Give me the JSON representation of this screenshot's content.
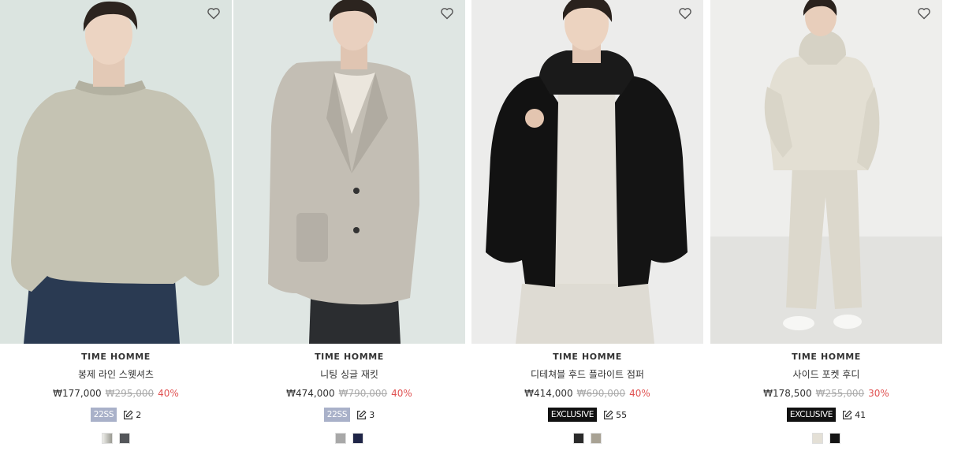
{
  "products": [
    {
      "brand": "TIME HOMME",
      "name": "봉제 라인 스웻셔츠",
      "price": "₩177,000",
      "original_price": "₩295,000",
      "discount": "40%",
      "badge": "22SS",
      "badge_type": "season",
      "reviews": "2",
      "colors": [
        "#dcdad2",
        "#54565a"
      ],
      "bg": "#dbe4e0"
    },
    {
      "brand": "TIME HOMME",
      "name": "니팅 싱글 재킷",
      "price": "₩474,000",
      "original_price": "₩790,000",
      "discount": "40%",
      "badge": "22SS",
      "badge_type": "season",
      "reviews": "3",
      "colors": [
        "#a8a8a8",
        "#1f2547"
      ],
      "bg": "#dfe6e3"
    },
    {
      "brand": "TIME HOMME",
      "name": "디테쳐블 후드 플라이트 점퍼",
      "price": "₩414,000",
      "original_price": "₩690,000",
      "discount": "40%",
      "badge": "EXCLUSIVE",
      "badge_type": "exclusive",
      "reviews": "55",
      "colors": [
        "#2a2a2a",
        "#a8a294"
      ],
      "bg": "#ececeb"
    },
    {
      "brand": "TIME HOMME",
      "name": "사이드 포켓 후디",
      "price": "₩178,500",
      "original_price": "₩255,000",
      "discount": "30%",
      "badge": "EXCLUSIVE",
      "badge_type": "exclusive",
      "reviews": "41",
      "colors": [
        "#e4e0d6",
        "#151515"
      ],
      "bg": "#eeeeec"
    }
  ]
}
